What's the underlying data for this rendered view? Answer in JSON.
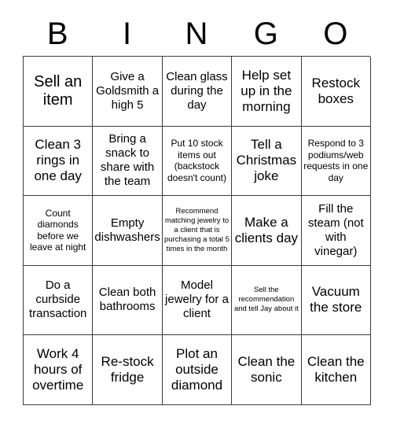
{
  "card": {
    "header_letters": [
      "B",
      "I",
      "N",
      "G",
      "O"
    ],
    "rows": [
      [
        {
          "text": "Sell an item",
          "size": "fs-xl"
        },
        {
          "text": "Give a Goldsmith a high 5",
          "size": "fs-md"
        },
        {
          "text": "Clean glass during the day",
          "size": "fs-md"
        },
        {
          "text": "Help set up in the morning",
          "size": "fs-lg"
        },
        {
          "text": "Restock boxes",
          "size": "fs-lg"
        }
      ],
      [
        {
          "text": "Clean 3 rings in one day",
          "size": "fs-lg"
        },
        {
          "text": "Bring a snack to share with the team",
          "size": "fs-md"
        },
        {
          "text": "Put 10 stock items out (backstock doesn't count)",
          "size": "fs-sm"
        },
        {
          "text": "Tell a Christmas joke",
          "size": "fs-lg"
        },
        {
          "text": "Respond to 3 podiums/web requests in one day",
          "size": "fs-sm"
        }
      ],
      [
        {
          "text": "Count diamonds before we leave at night",
          "size": "fs-sm"
        },
        {
          "text": "Empty dishwashers",
          "size": "fs-md"
        },
        {
          "text": "Recommend matching jewelry to a client that is purchasing a total 5 times in the month",
          "size": "fs-xs"
        },
        {
          "text": "Make a clients day",
          "size": "fs-lg"
        },
        {
          "text": "Fill the steam (not with vinegar)",
          "size": "fs-md"
        }
      ],
      [
        {
          "text": "Do a curbside transaction",
          "size": "fs-md"
        },
        {
          "text": "Clean both bathrooms",
          "size": "fs-md"
        },
        {
          "text": "Model jewelry for a client",
          "size": "fs-md"
        },
        {
          "text": "Sell the recommendation and tell Jay about it",
          "size": "fs-xs"
        },
        {
          "text": "Vacuum the store",
          "size": "fs-lg"
        }
      ],
      [
        {
          "text": "Work 4 hours of overtime",
          "size": "fs-lg"
        },
        {
          "text": "Re-stock fridge",
          "size": "fs-lg"
        },
        {
          "text": "Plot an outside diamond",
          "size": "fs-lg"
        },
        {
          "text": "Clean the sonic",
          "size": "fs-lg"
        },
        {
          "text": "Clean the kitchen",
          "size": "fs-lg"
        }
      ]
    ]
  },
  "colors": {
    "background": "#ffffff",
    "border": "#3b3b3b",
    "text": "#000000"
  }
}
